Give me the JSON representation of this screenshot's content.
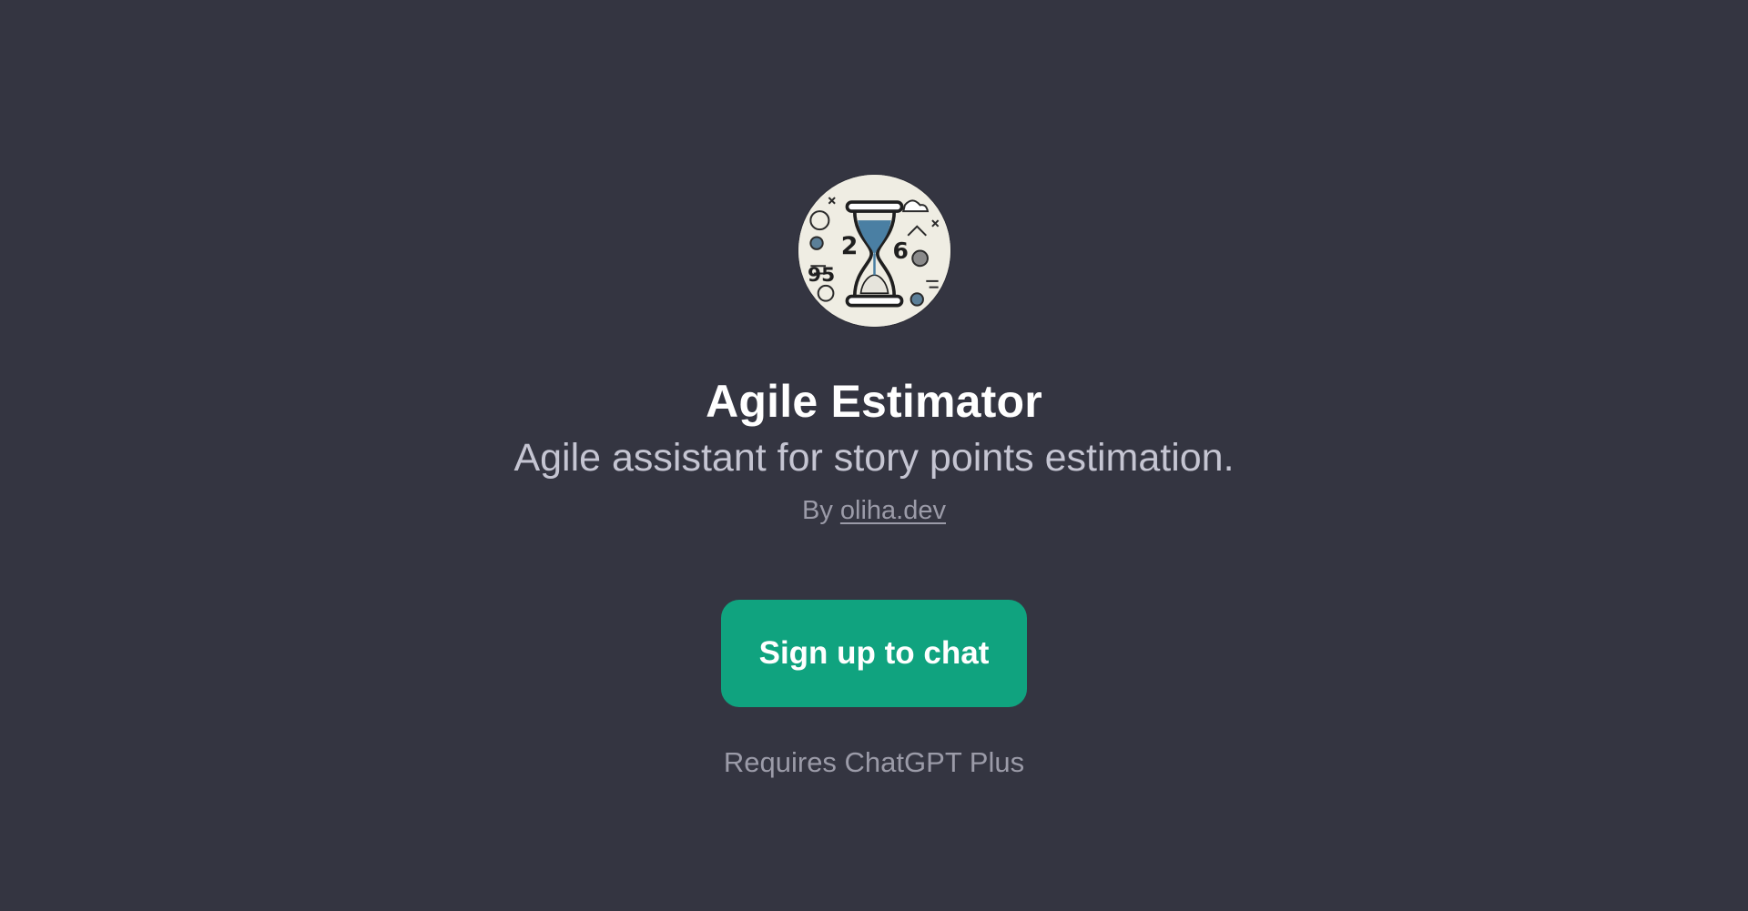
{
  "gpt": {
    "avatar_icon": "hourglass-doodle-icon",
    "title": "Agile Estimator",
    "description": "Agile assistant for story points estimation.",
    "byline_prefix": "By",
    "author": "oliha.dev"
  },
  "cta": {
    "label": "Sign up to chat"
  },
  "requirement_note": "Requires ChatGPT Plus",
  "colors": {
    "background": "#343541",
    "accent": "#10a37f",
    "title": "#ffffff",
    "subtitle": "#c5c5d2",
    "muted": "#9b9ba8"
  }
}
